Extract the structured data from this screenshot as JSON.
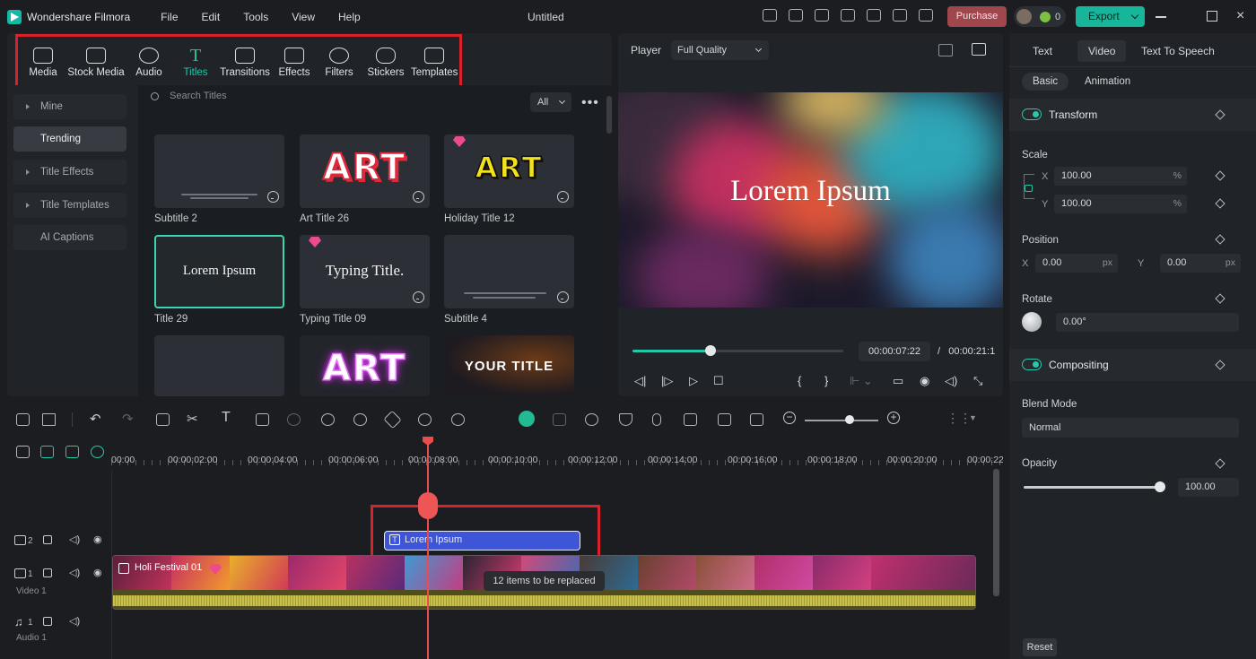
{
  "app": {
    "name": "Wondershare Filmora",
    "document_title": "Untitled"
  },
  "menu": [
    "File",
    "Edit",
    "Tools",
    "View",
    "Help"
  ],
  "topbar": {
    "purchase_label": "Purchase",
    "coin_count": "0",
    "export_label": "Export"
  },
  "media_tabs": [
    {
      "label": "Media",
      "icon": "media-icon"
    },
    {
      "label": "Stock Media",
      "icon": "stock-media-icon"
    },
    {
      "label": "Audio",
      "icon": "music-note-icon"
    },
    {
      "label": "Titles",
      "icon": "title-t-icon",
      "active": true
    },
    {
      "label": "Transitions",
      "icon": "transition-icon"
    },
    {
      "label": "Effects",
      "icon": "effects-icon"
    },
    {
      "label": "Filters",
      "icon": "filter-icon"
    },
    {
      "label": "Stickers",
      "icon": "sticker-icon"
    },
    {
      "label": "Templates",
      "icon": "template-icon"
    }
  ],
  "sidenav": [
    {
      "label": "Mine",
      "expandable": true
    },
    {
      "label": "Trending",
      "active": true
    },
    {
      "label": "Title Effects",
      "expandable": true
    },
    {
      "label": "Title Templates",
      "expandable": true
    },
    {
      "label": "AI Captions"
    }
  ],
  "search": {
    "placeholder": "Search Titles",
    "filter_value": "All"
  },
  "titles_grid": [
    {
      "name": "Subtitle 2",
      "preview": "",
      "downloadable": true
    },
    {
      "name": "Art Title 26",
      "preview": "ART",
      "downloadable": true
    },
    {
      "name": "Holiday Title 12",
      "preview": "ART",
      "premium": true,
      "downloadable": true
    },
    {
      "name": "Title 29",
      "preview": "Lorem Ipsum",
      "selected": true
    },
    {
      "name": "Typing Title 09",
      "preview": "Typing Title.",
      "premium": true,
      "downloadable": true
    },
    {
      "name": "Subtitle 4",
      "preview": "",
      "downloadable": true
    },
    {
      "name": "",
      "preview": ""
    },
    {
      "name": "",
      "preview": "ART"
    },
    {
      "name": "",
      "preview": "YOUR TITLE"
    }
  ],
  "player": {
    "label": "Player",
    "quality": "Full Quality",
    "preview_text": "Lorem Ipsum",
    "current_time": "00:00:07:22",
    "separator": "/",
    "total_time": "00:00:21:1",
    "progress_fraction": 0.37
  },
  "inspector": {
    "tabs": [
      "Text",
      "Video",
      "Text To Speech"
    ],
    "active_tab": "Video",
    "subtabs": [
      "Basic",
      "Animation"
    ],
    "transform": {
      "title": "Transform",
      "scale_label": "Scale",
      "scale_x": "100.00",
      "scale_y": "100.00",
      "scale_unit": "%",
      "position_label": "Position",
      "position_x": "0.00",
      "position_y": "0.00",
      "position_unit": "px",
      "rotate_label": "Rotate",
      "rotate_value": "0.00°"
    },
    "compositing": {
      "title": "Compositing",
      "blend_label": "Blend Mode",
      "blend_value": "Normal",
      "opacity_label": "Opacity",
      "opacity_value": "100.00"
    },
    "reset_label": "Reset"
  },
  "timeline": {
    "ruler": [
      "00:00",
      "00:00:02:00",
      "00:00:04:00",
      "00:00:06:00",
      "00:00:08:00",
      "00:00:10:00",
      "00:00:12:00",
      "00:00:14:00",
      "00:00:16:00",
      "00:00:18:00",
      "00:00:20:00",
      "00:00:22"
    ],
    "title_clip": "Lorem Ipsum",
    "video_clip": "Holi Festival 01",
    "replace_tooltip": "12 items to be replaced",
    "tracks": [
      {
        "index": "2",
        "label": ""
      },
      {
        "index": "1",
        "label": "Video 1"
      },
      {
        "index": "1",
        "label": "Audio 1"
      }
    ]
  },
  "colors": {
    "accent": "#21c7a8",
    "highlight_box": "#d8212a",
    "title_clip": "#3d55d6",
    "playhead": "#e94c4c"
  }
}
